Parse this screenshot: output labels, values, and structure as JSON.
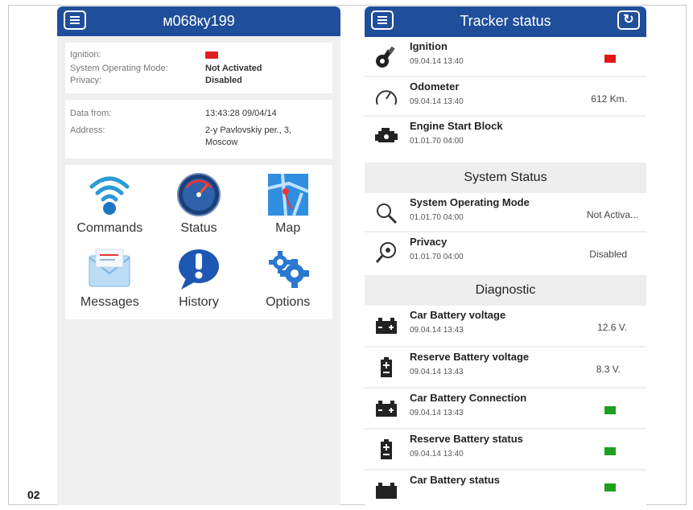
{
  "figure_number": "02",
  "left": {
    "header_title": "м068ку199",
    "status": [
      {
        "key": "Ignition:",
        "value": ""
      },
      {
        "key": "System Operating Mode:",
        "value": "Not Activated"
      },
      {
        "key": "Privacy:",
        "value": "Disabled"
      }
    ],
    "location": [
      {
        "key": "Data from:",
        "value": "13:43:28 09/04/14"
      },
      {
        "key": "Address:",
        "value": "2-y Pavlovskiy per., 3, Moscow"
      }
    ],
    "tiles": [
      {
        "label": "Commands",
        "icon": "wifi-signal-icon"
      },
      {
        "label": "Status",
        "icon": "speedometer-icon"
      },
      {
        "label": "Map",
        "icon": "map-icon"
      },
      {
        "label": "Messages",
        "icon": "envelope-icon"
      },
      {
        "label": "History",
        "icon": "exclamation-bubble-icon"
      },
      {
        "label": "Options",
        "icon": "gears-icon"
      }
    ],
    "colors": {
      "indicator_red": "#e02020"
    }
  },
  "right": {
    "header_title": "Tracker status",
    "rows_top": [
      {
        "title": "Ignition",
        "date": "09.04.14 13:40",
        "value": "",
        "indicator": "red",
        "icon": "key-icon"
      },
      {
        "title": "Odometer",
        "date": "09.04.14 13:40",
        "value": "612 Km.",
        "icon": "gauge-icon"
      },
      {
        "title": "Engine Start Block",
        "date": "01.01.70 04:00",
        "value": "",
        "icon": "engine-icon"
      }
    ],
    "section_system": "System Status",
    "rows_system": [
      {
        "title": "System Operating Mode",
        "date": "01.01.70 04:00",
        "value": "Not Activa...",
        "icon": "magnifier-icon"
      },
      {
        "title": "Privacy",
        "date": "01.01.70 04:00",
        "value": "Disabled",
        "icon": "eye-magnifier-icon"
      }
    ],
    "section_diag": "Diagnostic",
    "rows_diag": [
      {
        "title": "Car Battery voltage",
        "date": "09.04.14 13:43",
        "value": "12.6 V.",
        "icon": "car-battery-icon"
      },
      {
        "title": "Reserve Battery voltage",
        "date": "09.04.14 13:43",
        "value": "8.3 V.",
        "icon": "reserve-battery-icon"
      },
      {
        "title": "Car Battery Connection",
        "date": "09.04.14 13:43",
        "value": "",
        "indicator": "green",
        "icon": "car-battery-icon"
      },
      {
        "title": "Reserve Battery status",
        "date": "09.04.14 13:40",
        "value": "",
        "indicator": "green",
        "icon": "reserve-battery-icon"
      },
      {
        "title": "Car Battery status",
        "date": "",
        "value": "",
        "indicator": "green",
        "icon": "car-battery-icon"
      }
    ],
    "colors": {
      "header": "#1f4e9a",
      "indicator_green": "#1ea11e",
      "indicator_red": "#e01818"
    }
  }
}
